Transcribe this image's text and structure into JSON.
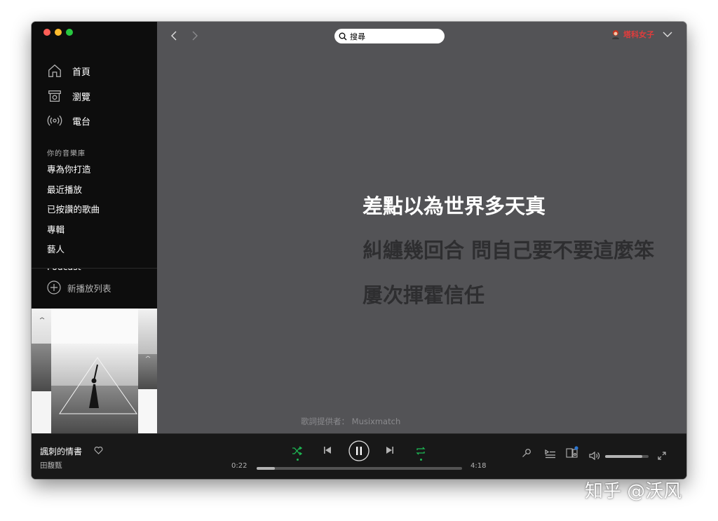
{
  "window": {
    "traffic_lights": [
      "#ff5f57",
      "#febc2e",
      "#28c840"
    ]
  },
  "sidebar": {
    "nav": [
      {
        "label": "首頁",
        "icon": "home-icon"
      },
      {
        "label": "瀏覽",
        "icon": "browse-icon"
      },
      {
        "label": "電台",
        "icon": "radio-icon"
      }
    ],
    "library_title": "你的音樂庫",
    "library_items": [
      "專為你打造",
      "最近播放",
      "已按讚的歌曲",
      "專輯",
      "藝人",
      "Podcast"
    ],
    "new_playlist": "新播放列表",
    "cover_icon": "album-cover-image"
  },
  "topbar": {
    "search_value": "搜尋",
    "user_name": "塔科女子"
  },
  "lyrics": {
    "lines": [
      "差點以為世界多天真",
      "糾纏幾回合 問自己要不要這麼笨",
      "屢次揮霍信任"
    ],
    "active_color": "#ffffff",
    "inactive_color": "#2e2e30",
    "credit": "歌詞提供者： Musixmatch"
  },
  "now_playing": {
    "title": "諷刺的情書",
    "artist": "田馥甄",
    "elapsed": "0:22",
    "duration": "4:18",
    "progress": 0.088,
    "volume": 0.85,
    "accent": "#1db954"
  },
  "watermark": "知乎 @沃风"
}
